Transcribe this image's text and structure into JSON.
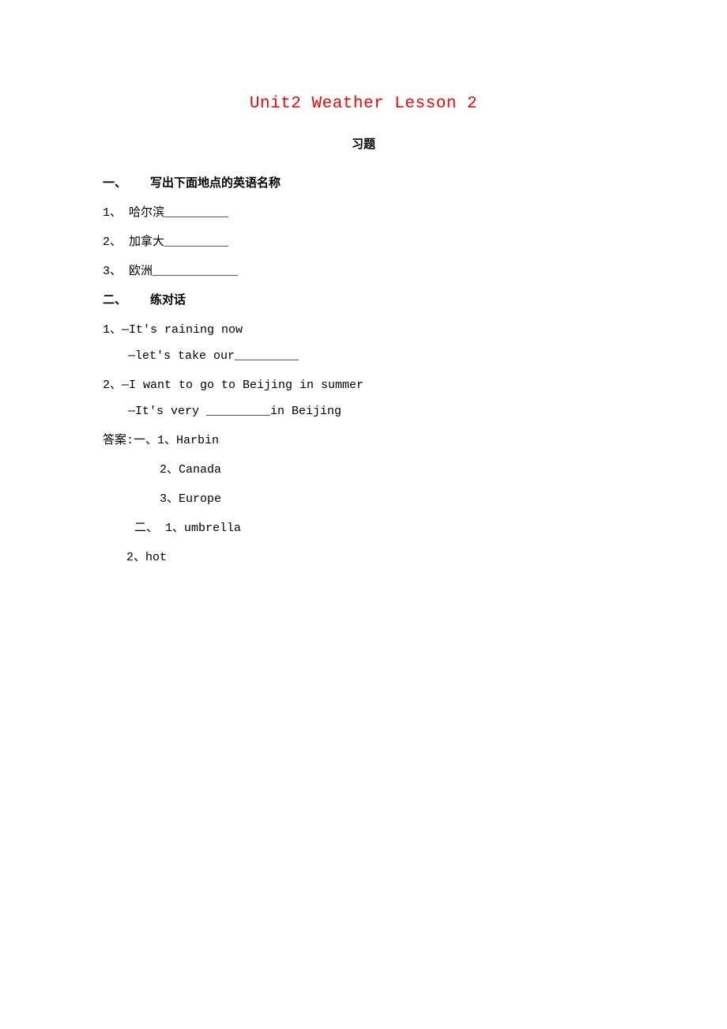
{
  "title": "Unit2 Weather Lesson 2",
  "subtitle": "习题",
  "section1": {
    "header_num": "一、",
    "header_text": "写出下面地点的英语名称",
    "q1": "1、 哈尔滨_________",
    "q2": "2、 加拿大_________",
    "q3": "3、 欧洲____________"
  },
  "section2": {
    "header_num": "二、",
    "header_text": "练对话",
    "q1a": "1、—It's raining now",
    "q1b": "—let's take our_________",
    "q2a": "2、—I want to go to Beijing in summer",
    "q2b": "—It's very _________in Beijing"
  },
  "answers": {
    "line1": "答案:一、1、Harbin",
    "line2": "2、Canada",
    "line3": "3、Europe",
    "line4": "二、 1、umbrella",
    "line5": "2、hot"
  }
}
